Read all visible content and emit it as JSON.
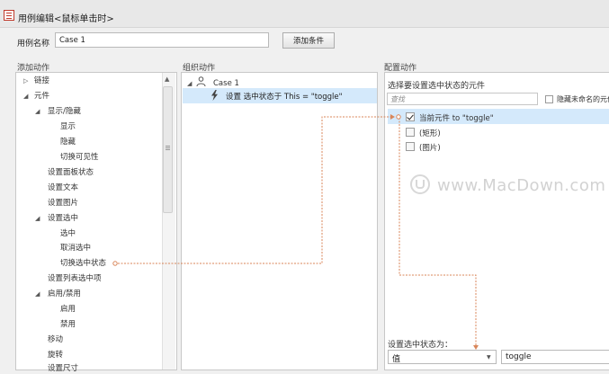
{
  "window": {
    "title": "用例编辑<鼠标单击时>"
  },
  "case_name": {
    "label": "用例名称",
    "value": "Case 1"
  },
  "toolbar": {
    "add_condition_label": "添加条件"
  },
  "headers": {
    "add_action": "添加动作",
    "organize_action": "组织动作",
    "config_action": "配置动作"
  },
  "action_tree": {
    "link": "链接",
    "element": "元件",
    "show_hide": "显示/隐藏",
    "show": "显示",
    "hide": "隐藏",
    "toggle_visibility": "切换可见性",
    "set_panel_state": "设置面板状态",
    "set_text": "设置文本",
    "set_image": "设置图片",
    "set_selected": "设置选中",
    "select": "选中",
    "unselect": "取消选中",
    "toggle_selected": "切换选中状态",
    "set_list_selected": "设置列表选中项",
    "enable_disable": "启用/禁用",
    "enable": "启用",
    "disable": "禁用",
    "move": "移动",
    "rotate": "旋转",
    "set_size": "设置尺寸"
  },
  "organize": {
    "case_label": "Case 1",
    "action_text": "设置 选中状态于 This = \"toggle\""
  },
  "config": {
    "select_widget_label": "选择要设置选中状态的元件",
    "search_placeholder": "查找",
    "hide_unnamed_label": "隐藏未命名的元件",
    "widgets": [
      {
        "label": "当前元件 to \"toggle\"",
        "checked": true
      },
      {
        "label": "(矩形)",
        "checked": false
      },
      {
        "label": "(图片)",
        "checked": false
      }
    ],
    "state_label": "设置选中状态为：",
    "value_type": "值",
    "value": "toggle"
  },
  "watermark": {
    "text": "www.MacDown.com"
  },
  "colors": {
    "selection": "#d4e9fb",
    "connector": "#d9865a"
  }
}
